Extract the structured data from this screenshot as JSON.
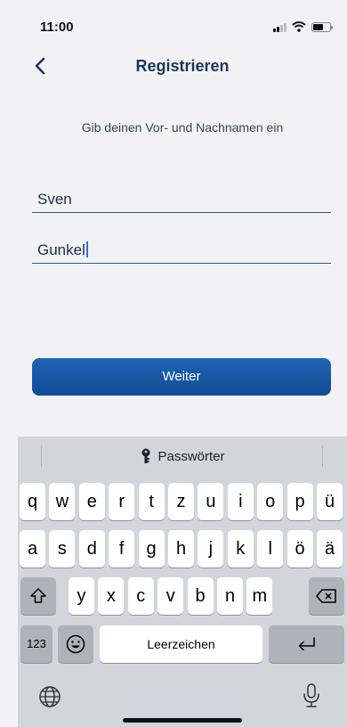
{
  "status": {
    "time": "11:00"
  },
  "nav": {
    "title": "Registrieren"
  },
  "form": {
    "instruction": "Gib deinen Vor- und Nachnamen ein",
    "first_name": "Sven",
    "last_name": "Gunkel",
    "submit_label": "Weiter"
  },
  "keyboard": {
    "suggestion": "Passwörter",
    "row1": [
      "q",
      "w",
      "e",
      "r",
      "t",
      "z",
      "u",
      "i",
      "o",
      "p",
      "ü"
    ],
    "row2": [
      "a",
      "s",
      "d",
      "f",
      "g",
      "h",
      "j",
      "k",
      "l",
      "ö",
      "ä"
    ],
    "row3": [
      "y",
      "x",
      "c",
      "v",
      "b",
      "n",
      "m"
    ],
    "numbers_label": "123",
    "space_label": "Leerzeichen"
  },
  "colors": {
    "accent": "#1a5aa8",
    "keyboard_bg": "#d3d5dc"
  }
}
